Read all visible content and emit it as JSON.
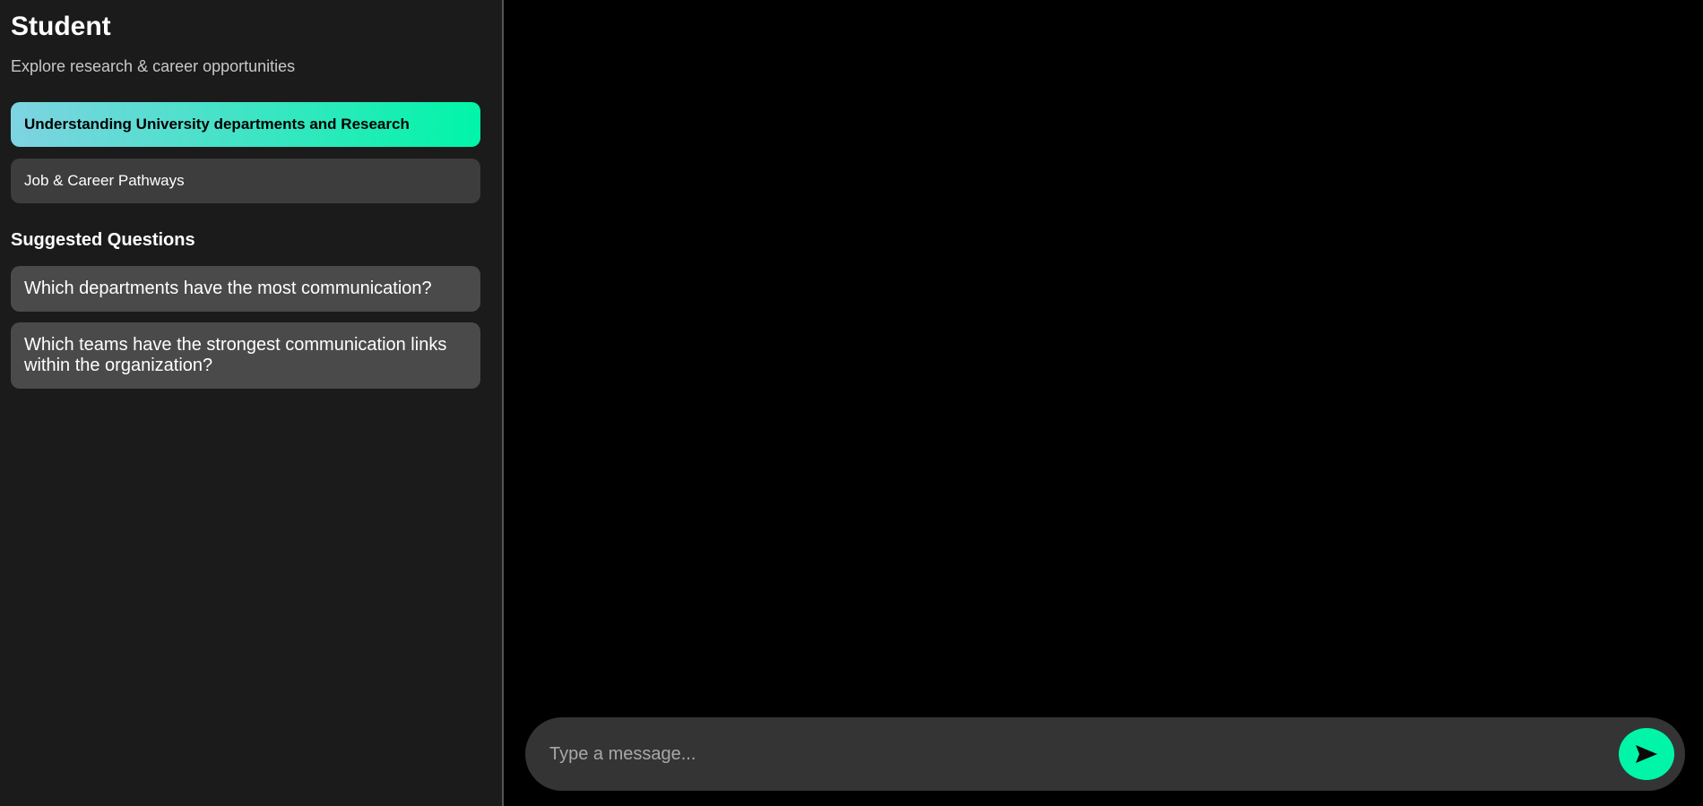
{
  "sidebar": {
    "title": "Student",
    "subtitle": "Explore research & career opportunities",
    "modes": [
      {
        "label": "Understanding University departments and Research",
        "active": true
      },
      {
        "label": "Job & Career Pathways",
        "active": false
      }
    ],
    "suggested_heading": "Suggested Questions",
    "questions": [
      "Which departments have the most communication?",
      "Which teams have the strongest communication links within the organization?"
    ]
  },
  "composer": {
    "placeholder": "Type a message...",
    "send_icon": "send-arrow-icon"
  },
  "colors": {
    "accent": "#00f5a8",
    "accent_gradient_start": "#7fd3e2",
    "sidebar_bg": "#1b1b1b",
    "chat_bg": "#000000",
    "composer_bg": "#343434"
  }
}
